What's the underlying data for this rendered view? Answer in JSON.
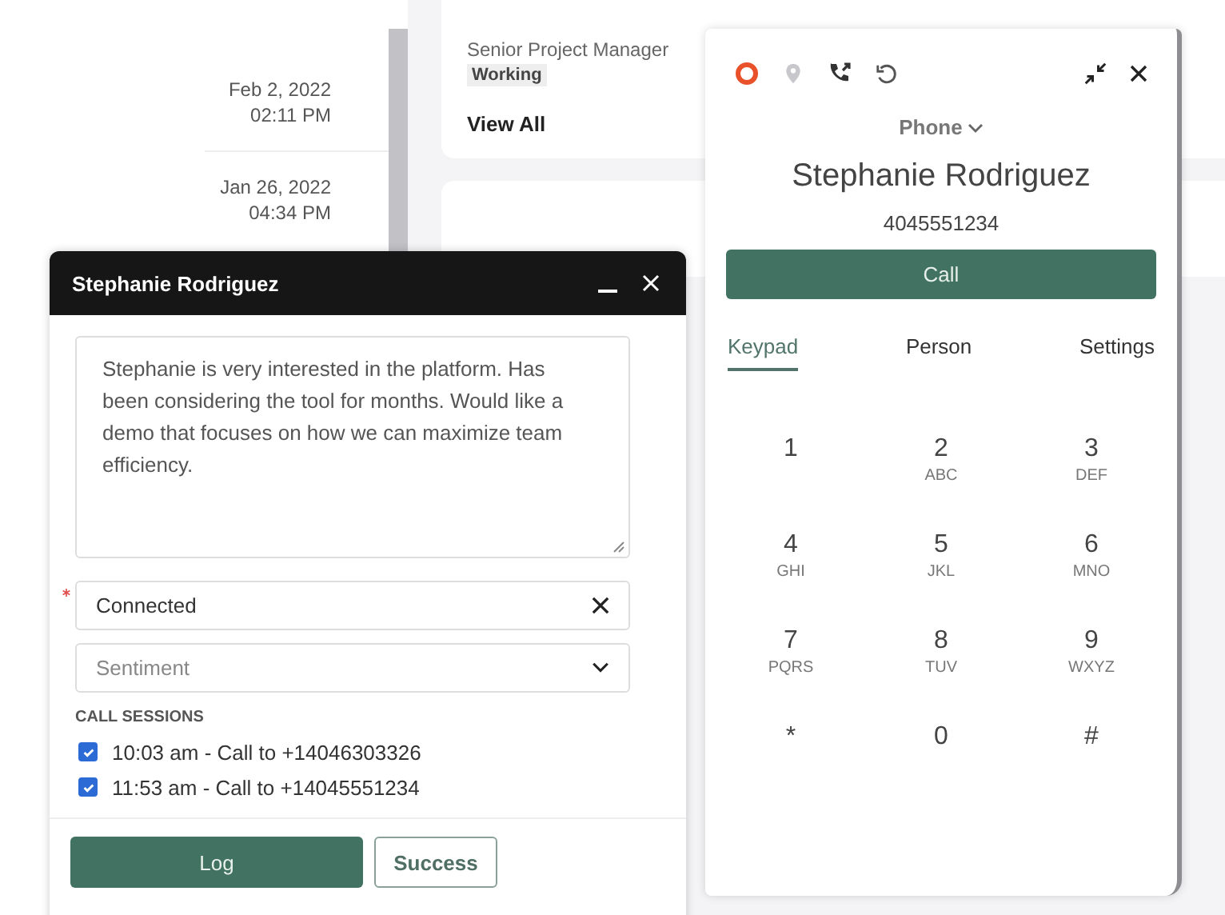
{
  "activity": [
    {
      "date": "Feb 2, 2022",
      "time": "02:11 PM"
    },
    {
      "date": "Jan 26, 2022",
      "time": "04:34 PM"
    }
  ],
  "contact_card": {
    "title": "Senior Project Manager",
    "status": "Working",
    "link": "View All"
  },
  "phone": {
    "source": "Phone",
    "name": "Stephanie Rodriguez",
    "number": "4045551234",
    "call_button": "Call",
    "tabs": [
      {
        "label": "Keypad",
        "selected": true
      },
      {
        "label": "Person",
        "selected": false
      },
      {
        "label": "Settings",
        "selected": false
      }
    ],
    "keys": [
      {
        "digit": "1"
      },
      {
        "digit": "2",
        "letters": "ABC"
      },
      {
        "digit": "3",
        "letters": "DEF"
      },
      {
        "digit": "4",
        "letters": "GHI"
      },
      {
        "digit": "5",
        "letters": "JKL"
      },
      {
        "digit": "6",
        "letters": "MNO"
      },
      {
        "digit": "7",
        "letters": "PQRS"
      },
      {
        "digit": "8",
        "letters": "TUV"
      },
      {
        "digit": "9",
        "letters": "WXYZ"
      },
      {
        "digit": "*"
      },
      {
        "digit": "0"
      },
      {
        "digit": "#"
      }
    ]
  },
  "note_window": {
    "title": "Stephanie Rodriguez",
    "note": "Stephanie is very interested in the platform. Has been considering the tool for months. Would like a demo that focuses on how we can maximize team efficiency.",
    "disposition": {
      "value": "Connected",
      "required": true
    },
    "sentiment": {
      "placeholder": "Sentiment"
    },
    "sessions_heading": "CALL SESSIONS",
    "sessions": [
      {
        "label": "10:03 am - Call to +14046303326",
        "checked": true
      },
      {
        "label": "11:53 am - Call to +14045551234",
        "checked": true
      }
    ],
    "buttons": [
      {
        "label": "Log",
        "kind": "primary"
      },
      {
        "label": "Success",
        "kind": "secondary"
      }
    ]
  }
}
